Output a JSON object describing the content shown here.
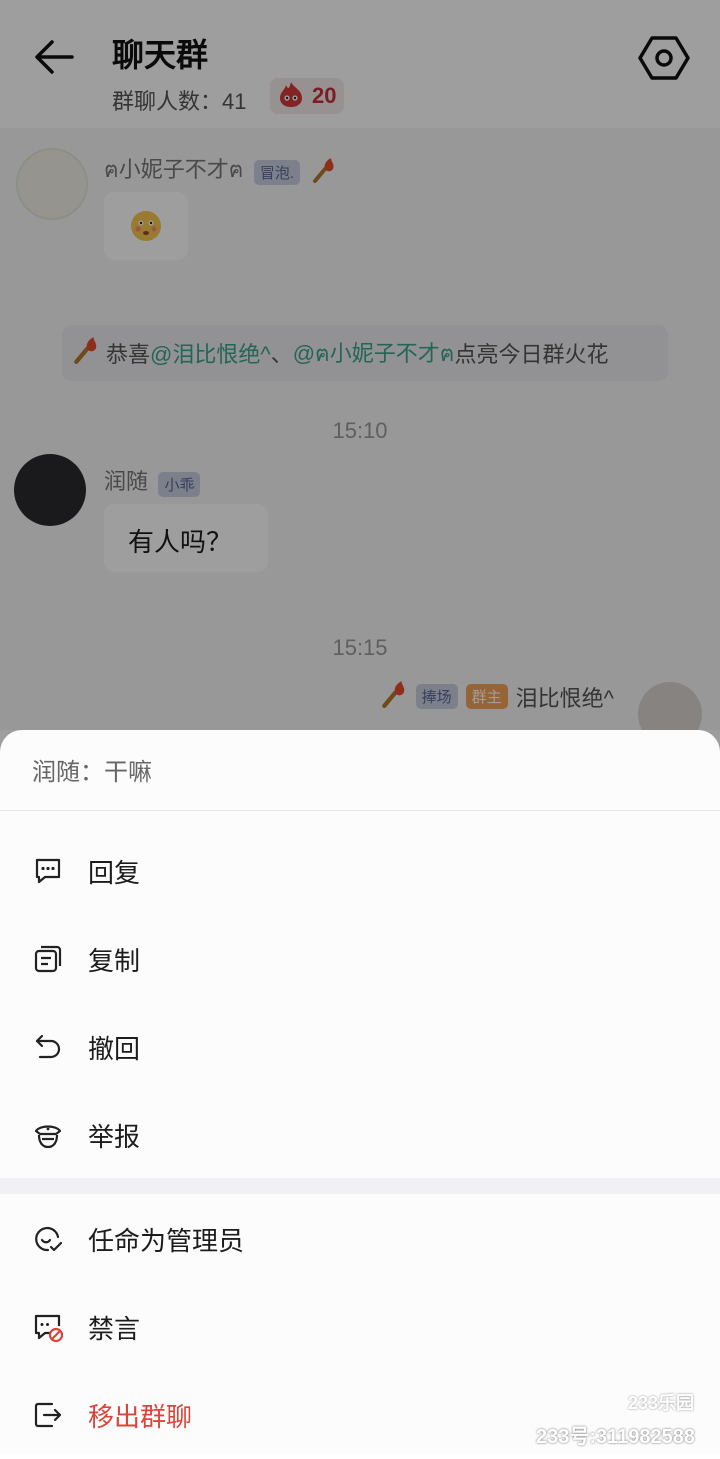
{
  "header": {
    "title": "聊天群",
    "member_label": "群聊人数：41",
    "fire_count": "20"
  },
  "messages": {
    "msg1": {
      "nick": "ฅ小妮子不才ฅ",
      "tag": "冒泡.",
      "content_icon": "flushed-emoji"
    },
    "notice": {
      "prefix": "恭喜",
      "mention1": "@泪比恨绝^",
      "sep": "、",
      "mention2": "@ฅ小妮子不才ฅ",
      "suffix": " 点亮今日群火花"
    },
    "time1": "15:10",
    "msg2": {
      "nick": "润随",
      "tag": "小乖",
      "text": "有人吗？"
    },
    "time2": "15:15",
    "msg3": {
      "nick": "泪比恨绝^",
      "tag1": "捧场",
      "tag2": "群主"
    }
  },
  "sheet": {
    "preview": "润随：干嘛",
    "items": [
      {
        "label": "回复",
        "icon": "reply-bubble-icon"
      },
      {
        "label": "复制",
        "icon": "copy-icon"
      },
      {
        "label": "撤回",
        "icon": "undo-icon"
      },
      {
        "label": "举报",
        "icon": "report-police-icon"
      },
      {
        "label": "任命为管理员",
        "icon": "admin-appoint-icon"
      },
      {
        "label": "禁言",
        "icon": "mute-icon"
      },
      {
        "label": "移出群聊",
        "icon": "remove-exit-icon"
      }
    ],
    "danger_color": "#d9453b"
  },
  "watermark": {
    "logo": "233乐园",
    "id": "233号:311982588"
  }
}
